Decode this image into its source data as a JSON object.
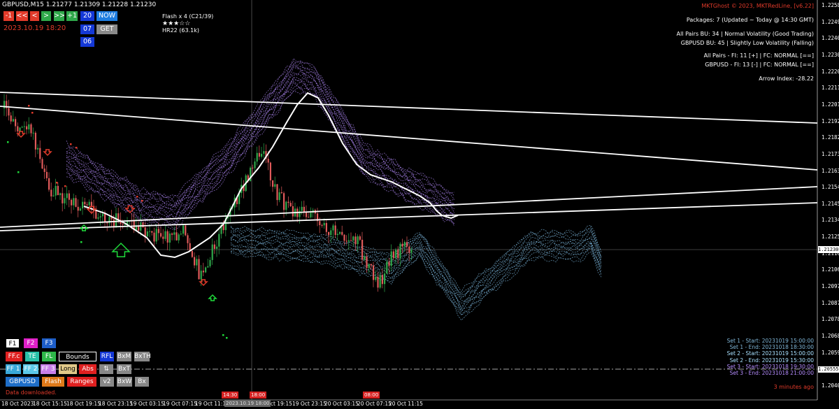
{
  "title_bar": {
    "symbol": "GBPUSD,M15",
    "ohlc": "1.21277 1.21309 1.21228 1.21230"
  },
  "nav_buttons": [
    {
      "label": "-1",
      "color": "#e03a2a"
    },
    {
      "label": "<<",
      "color": "#e03a2a"
    },
    {
      "label": "<",
      "color": "#e03a2a"
    },
    {
      "label": ">",
      "color": "#2fa84a"
    },
    {
      "label": ">>",
      "color": "#2fa84a"
    },
    {
      "label": "+1",
      "color": "#2fa84a"
    }
  ],
  "num_buttons": {
    "b20": "20",
    "b07": "07",
    "b06": "06",
    "now": "NOW",
    "get": "GET"
  },
  "current_datetime": "2023.10.19 18:20",
  "flash": {
    "line1": "Flash x 4 (C21/39)",
    "stars": "★★★☆☆",
    "line3": "HR22 (63.1k)"
  },
  "info_panel": {
    "copyright": "MKTGhost © 2023, MKTRedLine, [v6.22]",
    "packages": "Packages: 7 (Updated ~ Today @ 14:30 GMT)",
    "allpairs_bu": "All Pairs BU: 34 | Normal Volatility (Good Trading)",
    "gbpusd_bu": "GBPUSD BU: 45 | Slightly Low Volatility (Falling)",
    "allpairs_fi": "All Pairs - FI: 11 [+] | FC: NORMAL [==]",
    "gbpusd_fi": "GBPUSD - FI: 13 [-] | FC: NORMAL [==]",
    "arrow_index": "Arrow Index: -28.22"
  },
  "y_axis": [
    "1.22585",
    "1.22495",
    "1.22400",
    "1.22300",
    "1.22205",
    "1.22110",
    "1.22015",
    "1.21920",
    "1.21825",
    "1.21730",
    "1.21635",
    "1.21540",
    "1.21450",
    "1.21345",
    "1.21250",
    "1.21165",
    "1.21065",
    "1.20970",
    "1.20875",
    "1.20780",
    "1.20685",
    "1.20590",
    "1.20495",
    "1.20400"
  ],
  "price_marker": "1.21230",
  "price_marker2": "1.20555",
  "x_axis": [
    "18 Oct 2023",
    "18 Oct 15:15",
    "18 Oct 19:15",
    "18 Oct 23:15",
    "19 Oct 03:15",
    "19 Oct 07:15",
    "19 Oct 11:15",
    "19 Oct 19:15",
    "19 Oct 23:15",
    "20 Oct 03:15",
    "20 Oct 07:15",
    "20 Oct 11:15"
  ],
  "crosshair_label": "2023.10.19 18:00",
  "time_tags": [
    "14:30",
    "18:00",
    "08:00"
  ],
  "sets": [
    {
      "label": "Set 1 - Start: 20231019 15:00:00",
      "color": "#7fb6d8"
    },
    {
      "label": "Set 1 - End: 20231018 18:30:00",
      "color": "#7fb6d8"
    },
    {
      "label": "Set 2 - Start: 20231019 15:00:00",
      "color": "#a8e0ff"
    },
    {
      "label": "Set 2 - End: 20231019 15:30:00",
      "color": "#a8e0ff"
    },
    {
      "label": "Set 3 - Start: 20231018 19:30:00",
      "color": "#b58cff"
    },
    {
      "label": "Set 3 - End: 20231018 21:00:00",
      "color": "#b58cff"
    }
  ],
  "last_update": "3 minutes ago",
  "status": "Data downloaded.",
  "bottom_buttons": {
    "row1": [
      "F1",
      "F2",
      "F3"
    ],
    "row2": [
      "FF.c",
      "TE",
      "FL",
      "Bounds",
      "RFL",
      "BxM",
      "BxTH"
    ],
    "row3": [
      "FF 1",
      "FF 2",
      "FF 3",
      "Long",
      "Abs",
      "⇅",
      "BxT"
    ],
    "row4": [
      "GBPUSD",
      "Flash",
      "Ranges",
      "v2",
      "BxW",
      "Bx"
    ]
  },
  "colors": {
    "candle_up": "#2fa84a",
    "candle_down": "#e05a5a",
    "projection_purple": "#b58cff",
    "projection_blue": "#8fd3ff",
    "trendline": "#ffffff",
    "ma": "#ffffff"
  }
}
